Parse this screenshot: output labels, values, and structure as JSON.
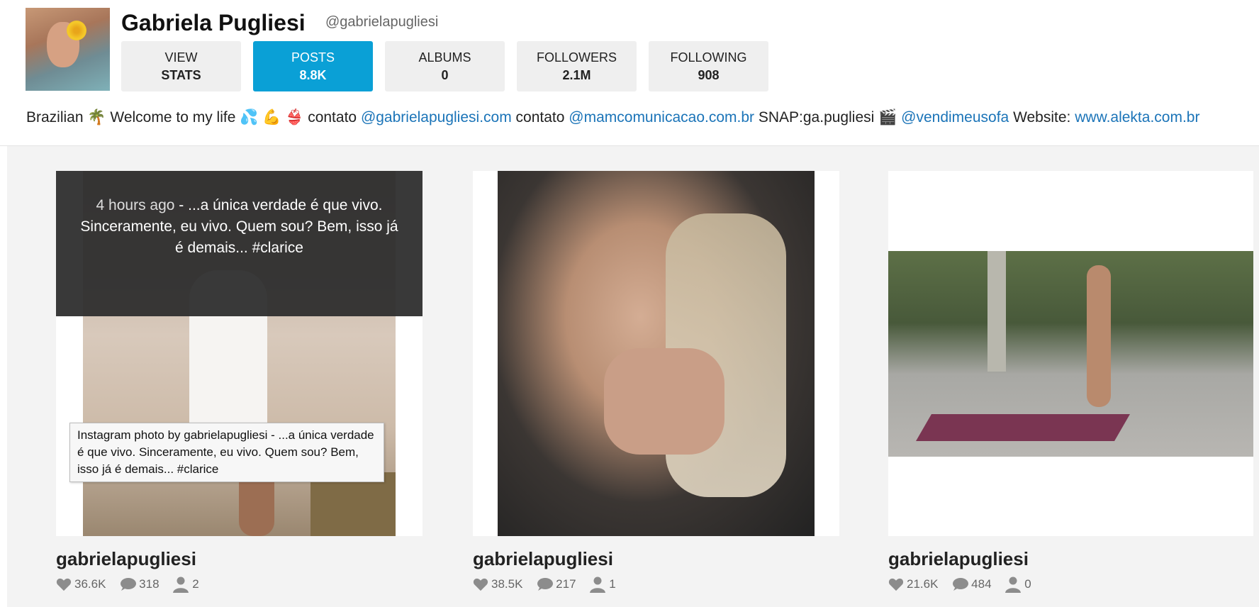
{
  "profile": {
    "name": "Gabriela Pugliesi",
    "handle": "@gabrielapugliesi",
    "avatar_icon": "profile-avatar"
  },
  "stats": [
    {
      "line1": "VIEW",
      "line2": "STATS",
      "active": false
    },
    {
      "line1": "POSTS",
      "line2": "8.8K",
      "active": true
    },
    {
      "line1": "ALBUMS",
      "line2": "0",
      "active": false
    },
    {
      "line1": "FOLLOWERS",
      "line2": "2.1M",
      "active": false
    },
    {
      "line1": "FOLLOWING",
      "line2": "908",
      "active": false
    }
  ],
  "bio": {
    "t1": "Brazilian",
    "e1": "🌴",
    "t2": "Welcome to my life",
    "e2": "💦 💪 👙",
    "t3": "contato",
    "l1": "@gabrielapugliesi.com",
    "t4": "contato",
    "l2": "@mamcomunicacao.com.br",
    "t5": "SNAP:ga.pugliesi",
    "e3": "🎬",
    "l3": "@vendimeusofa",
    "t6": "Website:",
    "l4": "www.alekta.com.br"
  },
  "colors": {
    "accent": "#0aa0d6",
    "link": "#1b74b8"
  },
  "posts": [
    {
      "overlay_time": "4 hours ago",
      "overlay_text": " - ...a única verdade é que vivo. Sinceramente, eu vivo. Quem sou? Bem, isso já é demais... #clarice",
      "tooltip": "Instagram photo by gabrielapugliesi - ...a única verdade é que vivo. Sinceramente, eu vivo. Quem sou? Bem, isso já é demais... #clarice",
      "author": "gabrielapugliesi",
      "likes": "36.6K",
      "comments": "318",
      "people": "2"
    },
    {
      "author": "gabrielapugliesi",
      "likes": "38.5K",
      "comments": "217",
      "people": "1"
    },
    {
      "author": "gabrielapugliesi",
      "likes": "21.6K",
      "comments": "484",
      "people": "0"
    }
  ]
}
